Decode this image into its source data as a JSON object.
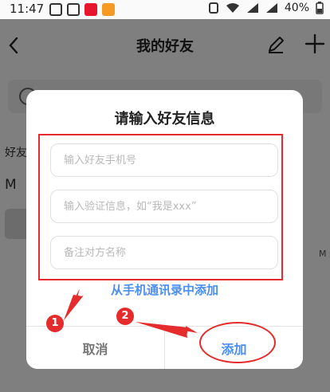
{
  "status_bar": {
    "time": "11:47",
    "battery": "40%"
  },
  "nav": {
    "title": "我的好友"
  },
  "background": {
    "section_label": "好友",
    "group_letter": "M",
    "index_letter": "M"
  },
  "dialog": {
    "title": "请输入好友信息",
    "phone_placeholder": "输入好友手机号",
    "verify_placeholder": "输入验证信息，如“我是xxx”",
    "remark_placeholder": "备注对方名称",
    "contacts_link": "从手机通讯录中添加",
    "cancel_label": "取消",
    "add_label": "添加"
  },
  "annotations": {
    "step1": "1",
    "step2": "2",
    "color": "#e52b2b"
  },
  "colors": {
    "accent": "#4a8ef0",
    "overlay": "rgba(0,0,0,0.5)"
  }
}
